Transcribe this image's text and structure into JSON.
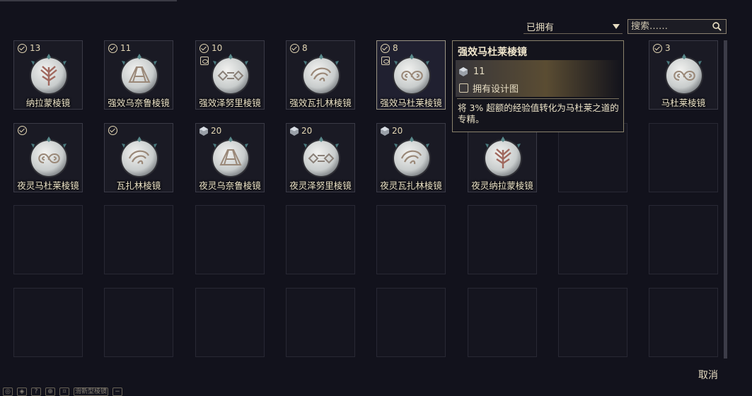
{
  "filter": {
    "selected": "已拥有"
  },
  "search": {
    "placeholder": "搜索……"
  },
  "items": [
    {
      "name": "纳拉蒙棱镜",
      "count": "13",
      "owned": true,
      "gem": false,
      "blueprint": false,
      "glyph": "tree"
    },
    {
      "name": "强效乌奈鲁棱镜",
      "count": "11",
      "owned": true,
      "gem": false,
      "blueprint": false,
      "glyph": "mountain"
    },
    {
      "name": "强效泽努里棱镜",
      "count": "10",
      "owned": true,
      "gem": false,
      "blueprint": true,
      "glyph": "diamond"
    },
    {
      "name": "强效瓦扎林棱镜",
      "count": "8",
      "owned": true,
      "gem": false,
      "blueprint": false,
      "glyph": "wave"
    },
    {
      "name": "强效马杜莱棱镜",
      "count": "8",
      "owned": true,
      "gem": false,
      "blueprint": true,
      "glyph": "cloud",
      "selected": true
    },
    {
      "name": "",
      "count": "",
      "owned": false,
      "gem": false,
      "blueprint": false,
      "glyph": "",
      "hidden": true
    },
    {
      "name": "",
      "count": "",
      "owned": false,
      "gem": false,
      "blueprint": false,
      "glyph": "",
      "hidden": true
    },
    {
      "name": "马杜莱棱镜",
      "count": "3",
      "owned": true,
      "gem": false,
      "blueprint": false,
      "glyph": "cloud"
    },
    {
      "name": "夜灵马杜莱棱镜",
      "count": "",
      "owned": true,
      "gem": false,
      "blueprint": false,
      "glyph": "cloud"
    },
    {
      "name": "瓦扎林棱镜",
      "count": "",
      "owned": true,
      "gem": false,
      "blueprint": false,
      "glyph": "wave"
    },
    {
      "name": "夜灵乌奈鲁棱镜",
      "count": "20",
      "owned": false,
      "gem": true,
      "blueprint": false,
      "glyph": "mountain"
    },
    {
      "name": "夜灵泽努里棱镜",
      "count": "20",
      "owned": false,
      "gem": true,
      "blueprint": false,
      "glyph": "diamond"
    },
    {
      "name": "夜灵瓦扎林棱镜",
      "count": "20",
      "owned": false,
      "gem": true,
      "blueprint": false,
      "glyph": "wave"
    },
    {
      "name": "夜灵纳拉蒙棱镜",
      "count": "",
      "owned": false,
      "gem": false,
      "blueprint": false,
      "glyph": "tree"
    }
  ],
  "tooltip": {
    "title": "强效马杜莱棱镜",
    "count": "11",
    "owned_blueprint": "拥有设计图",
    "description": "将 3% 超额的经验值转化为马杜莱之道的专精。"
  },
  "cancel_label": "取消",
  "hotkeys": [
    "◎",
    "◈",
    "?",
    "⊕",
    "⌗",
    "滑新型棱镜",
    "−"
  ]
}
